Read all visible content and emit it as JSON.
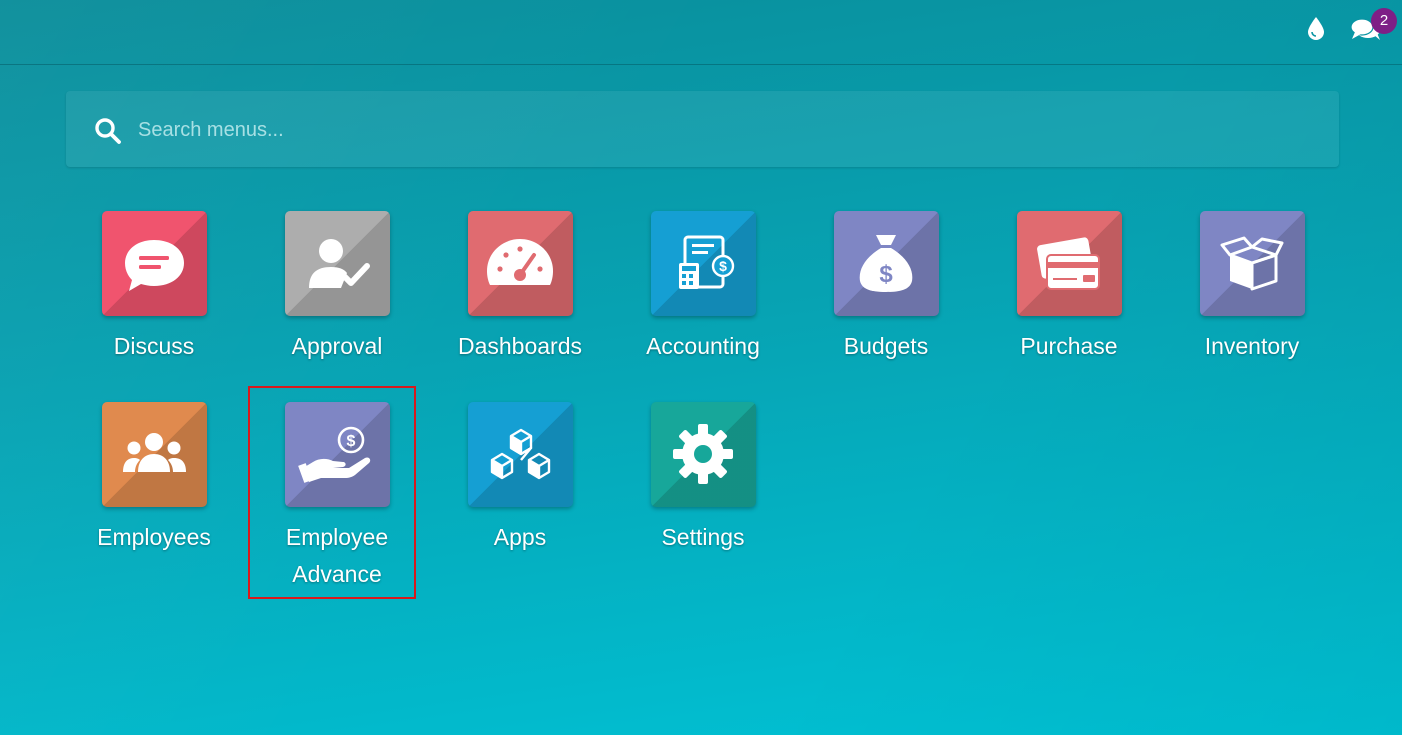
{
  "topbar": {
    "icons": [
      "debug-drop-icon",
      "chat-bubbles-icon"
    ],
    "messages_badge": "2",
    "badge_color": "#7e1f86"
  },
  "search": {
    "placeholder": "Search menus...",
    "value": ""
  },
  "apps": [
    {
      "label": "Discuss",
      "icon": "chat-bubble-icon",
      "color": "#f0546e"
    },
    {
      "label": "Approval",
      "icon": "user-check-icon",
      "color": "#adadad"
    },
    {
      "label": "Dashboards",
      "icon": "speedometer-icon",
      "color": "#e06b70"
    },
    {
      "label": "Accounting",
      "icon": "invoice-calculator-icon",
      "color": "#159fd3"
    },
    {
      "label": "Budgets",
      "icon": "money-bag-icon",
      "color": "#7f86c4"
    },
    {
      "label": "Purchase",
      "icon": "credit-card-icon",
      "color": "#e06b70"
    },
    {
      "label": "Inventory",
      "icon": "open-box-icon",
      "color": "#7f86c4"
    },
    {
      "label": "Employees",
      "icon": "group-icon",
      "color": "#e08a4e"
    },
    {
      "label": "Employee Advance",
      "label_line1": "Employee",
      "label_line2": "Advance",
      "icon": "hand-dollar-icon",
      "color": "#7f86c4",
      "highlighted": true
    },
    {
      "label": "Apps",
      "icon": "cubes-icon",
      "color": "#159fd3"
    },
    {
      "label": "Settings",
      "icon": "gear-icon",
      "color": "#17a79a"
    }
  ],
  "highlight_color": "#d9191c"
}
